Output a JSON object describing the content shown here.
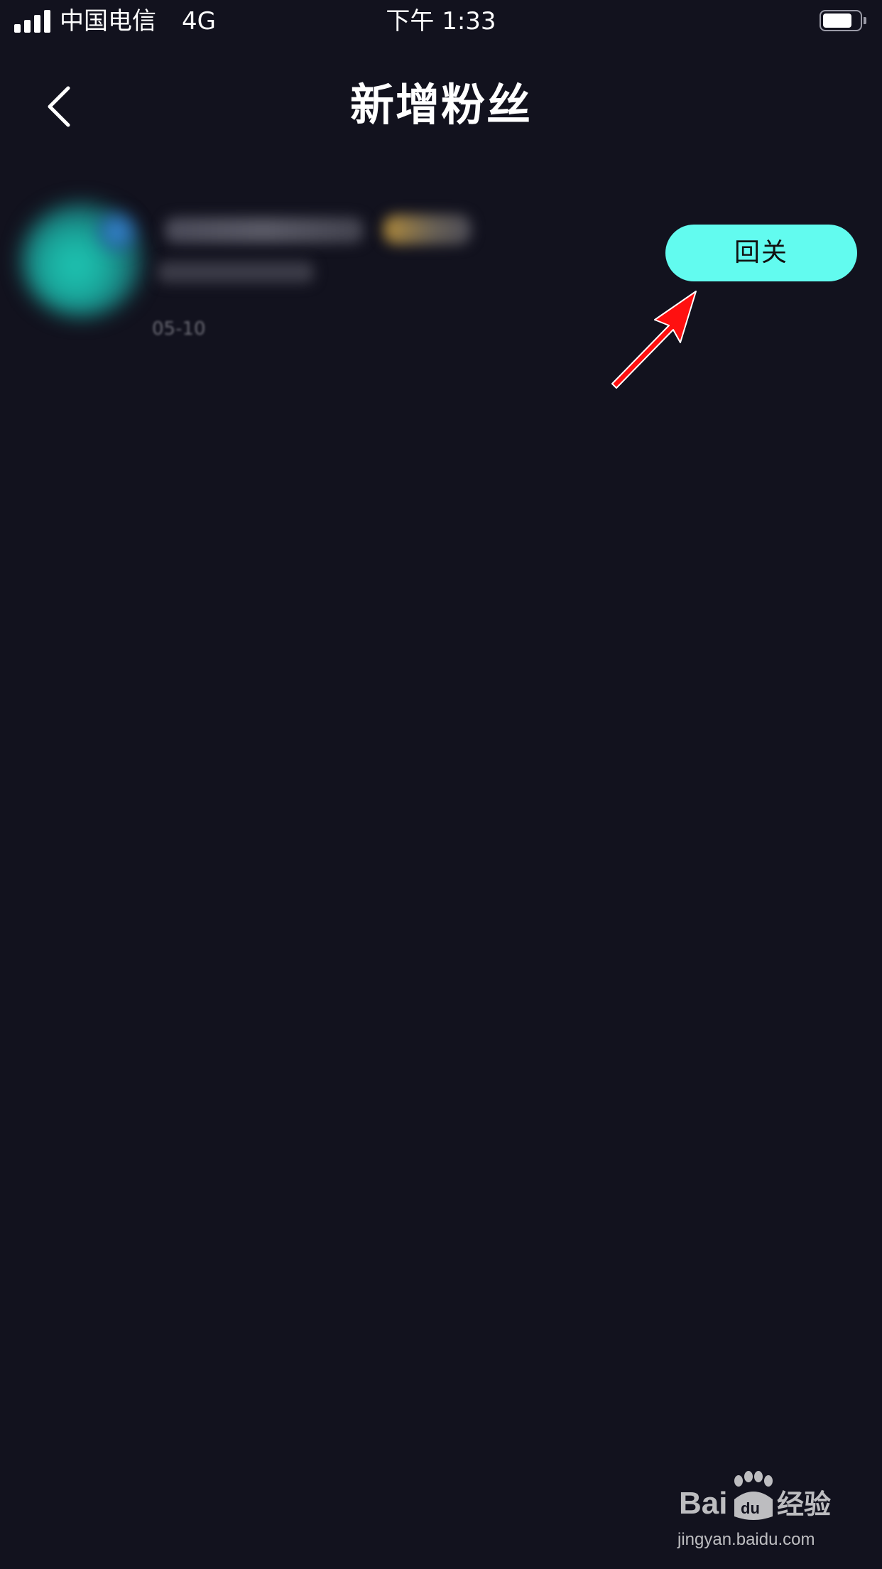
{
  "status_bar": {
    "carrier": "中国电信",
    "network": "4G",
    "time": "下午 1:33",
    "battery_level": 0.8
  },
  "nav": {
    "title": "新增粉丝",
    "back_icon": "chevron-left-icon"
  },
  "list": {
    "items": [
      {
        "date": "05-10",
        "follow_back_label": "回关"
      }
    ]
  },
  "colors": {
    "background": "#12121e",
    "button": "#62fbef",
    "annotation_arrow": "#ff1010"
  },
  "watermark": {
    "brand": "Baidu经验",
    "url": "jingyan.baidu.com"
  }
}
